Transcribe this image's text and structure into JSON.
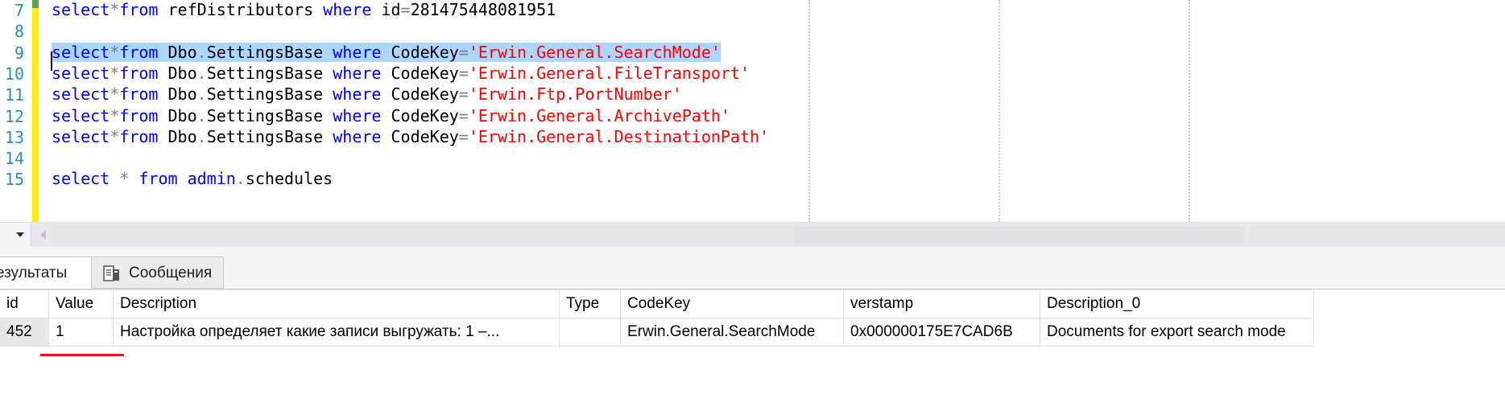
{
  "editor": {
    "lines": [
      {
        "num": "7",
        "tokens": [
          {
            "t": "select",
            "c": "kw"
          },
          {
            "t": "*",
            "c": "op"
          },
          {
            "t": "from",
            "c": "kw"
          },
          {
            "t": " refDistributors ",
            "c": "id"
          },
          {
            "t": "where",
            "c": "kw"
          },
          {
            "t": " id",
            "c": "id"
          },
          {
            "t": "=",
            "c": "op"
          },
          {
            "t": "281475448081951",
            "c": "id"
          }
        ]
      },
      {
        "num": "8",
        "tokens": []
      },
      {
        "num": "9",
        "selected": true,
        "tokens": [
          {
            "t": "select",
            "c": "kw"
          },
          {
            "t": "*",
            "c": "op"
          },
          {
            "t": "from",
            "c": "kw"
          },
          {
            "t": " Dbo",
            "c": "id"
          },
          {
            "t": ".",
            "c": "op"
          },
          {
            "t": "SettingsBase ",
            "c": "id"
          },
          {
            "t": "where",
            "c": "kw"
          },
          {
            "t": " CodeKey",
            "c": "id"
          },
          {
            "t": "=",
            "c": "op"
          },
          {
            "t": "'Erwin.General.SearchMode'",
            "c": "str"
          }
        ]
      },
      {
        "num": "10",
        "tokens": [
          {
            "t": "select",
            "c": "kw"
          },
          {
            "t": "*",
            "c": "op"
          },
          {
            "t": "from",
            "c": "kw"
          },
          {
            "t": " Dbo",
            "c": "id"
          },
          {
            "t": ".",
            "c": "op"
          },
          {
            "t": "SettingsBase ",
            "c": "id"
          },
          {
            "t": "where",
            "c": "kw"
          },
          {
            "t": " CodeKey",
            "c": "id"
          },
          {
            "t": "=",
            "c": "op"
          },
          {
            "t": "'Erwin.General.FileTransport'",
            "c": "str"
          }
        ]
      },
      {
        "num": "11",
        "tokens": [
          {
            "t": "select",
            "c": "kw"
          },
          {
            "t": "*",
            "c": "op"
          },
          {
            "t": "from",
            "c": "kw"
          },
          {
            "t": " Dbo",
            "c": "id"
          },
          {
            "t": ".",
            "c": "op"
          },
          {
            "t": "SettingsBase ",
            "c": "id"
          },
          {
            "t": "where",
            "c": "kw"
          },
          {
            "t": " CodeKey",
            "c": "id"
          },
          {
            "t": "=",
            "c": "op"
          },
          {
            "t": "'Erwin.Ftp.PortNumber'",
            "c": "str"
          }
        ]
      },
      {
        "num": "12",
        "tokens": [
          {
            "t": "select",
            "c": "kw"
          },
          {
            "t": "*",
            "c": "op"
          },
          {
            "t": "from",
            "c": "kw"
          },
          {
            "t": " Dbo",
            "c": "id"
          },
          {
            "t": ".",
            "c": "op"
          },
          {
            "t": "SettingsBase ",
            "c": "id"
          },
          {
            "t": "where",
            "c": "kw"
          },
          {
            "t": " CodeKey",
            "c": "id"
          },
          {
            "t": "=",
            "c": "op"
          },
          {
            "t": "'Erwin.General.ArchivePath'",
            "c": "str"
          }
        ]
      },
      {
        "num": "13",
        "tokens": [
          {
            "t": "select",
            "c": "kw"
          },
          {
            "t": "*",
            "c": "op"
          },
          {
            "t": "from",
            "c": "kw"
          },
          {
            "t": " Dbo",
            "c": "id"
          },
          {
            "t": ".",
            "c": "op"
          },
          {
            "t": "SettingsBase ",
            "c": "id"
          },
          {
            "t": "where",
            "c": "kw"
          },
          {
            "t": " CodeKey",
            "c": "id"
          },
          {
            "t": "=",
            "c": "op"
          },
          {
            "t": "'Erwin.General.DestinationPath'",
            "c": "str"
          }
        ]
      },
      {
        "num": "14",
        "tokens": []
      },
      {
        "num": "15",
        "tokens": [
          {
            "t": "select",
            "c": "kw"
          },
          {
            "t": " * ",
            "c": "op"
          },
          {
            "t": "from",
            "c": "kw"
          },
          {
            "t": " admin",
            "c": "kw"
          },
          {
            "t": ".",
            "c": "op"
          },
          {
            "t": "schedules",
            "c": "id"
          }
        ]
      }
    ]
  },
  "tabs": {
    "results_label": "езультаты",
    "messages_label": "Сообщения",
    "messages_icon": "messages-icon"
  },
  "grid": {
    "columns": [
      "id",
      "Value",
      "Description",
      "Type",
      "CodeKey",
      "verstamp",
      "Description_0"
    ],
    "rows": [
      [
        "452",
        "1",
        "Настройка определяет какие записи выгружать: 1 –...",
        "",
        "Erwin.General.SearchMode",
        "0x000000175E7CAD6B",
        "Documents for export search mode"
      ]
    ]
  },
  "colors": {
    "keyword": "#0000ff",
    "string": "#ff0000",
    "line_number": "#2b91af",
    "selection": "#add6ff",
    "change_bar": "#ffef00",
    "annotation_underline": "#e01b1b"
  }
}
